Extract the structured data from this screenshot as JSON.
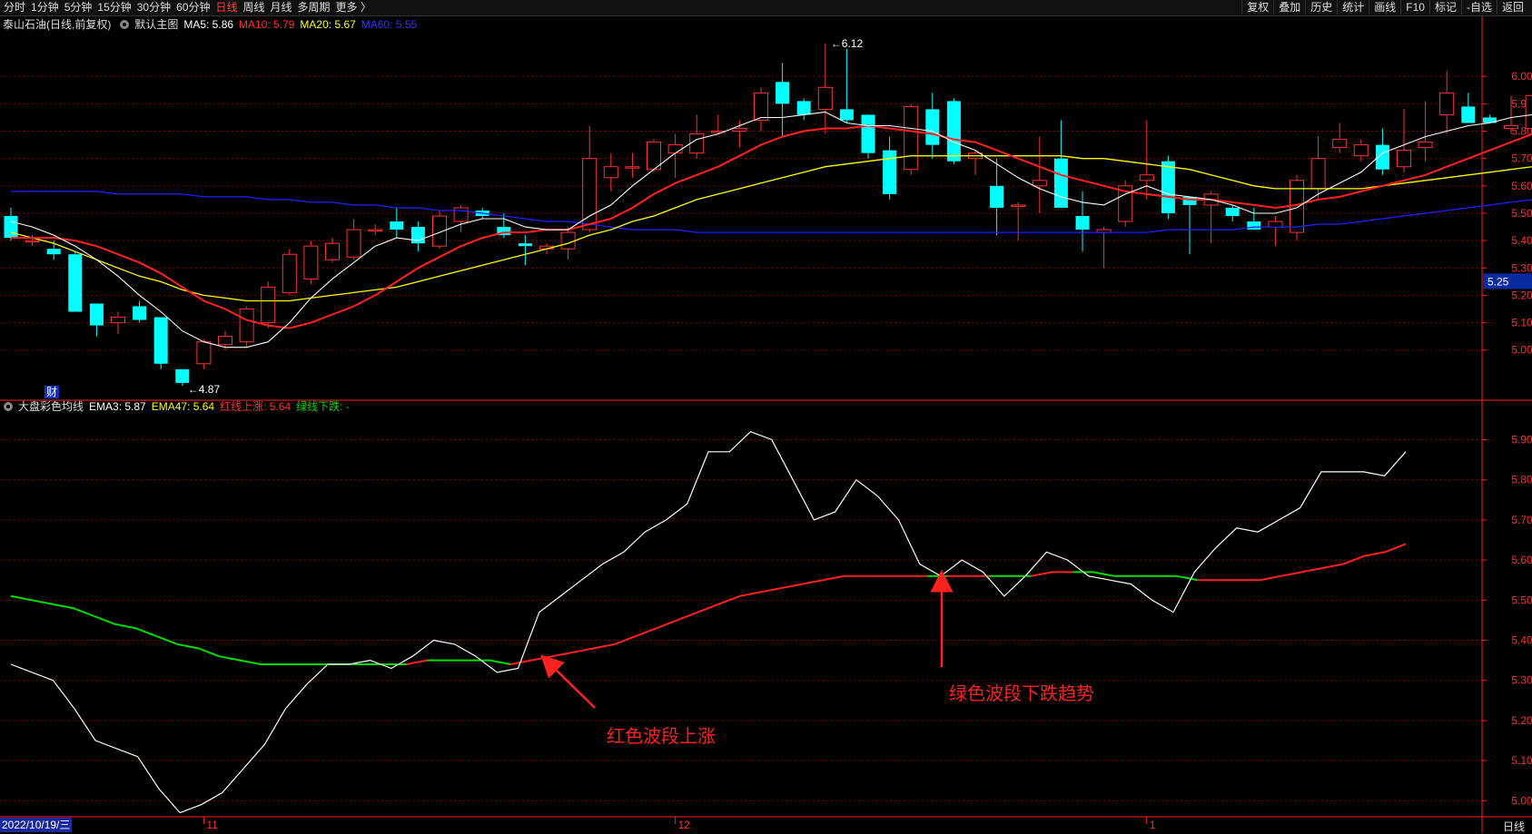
{
  "toolbar": {
    "periods": [
      "分时",
      "1分钟",
      "5分钟",
      "15分钟",
      "30分钟",
      "60分钟",
      "日线",
      "周线",
      "月线",
      "多周期",
      "更多 〉"
    ],
    "active_period": "日线",
    "right_buttons": [
      "复权",
      "叠加",
      "历史",
      "统计",
      "画线",
      "F10",
      "标记",
      "-自选",
      "返回"
    ]
  },
  "main_info": {
    "stock": "泰山石油(日线,前复权)",
    "indicator": "默认主图",
    "ma5": "MA5: 5.86",
    "ma10": "MA10: 5.79",
    "ma20": "MA20: 5.67",
    "ma60": "MA60: 5.55"
  },
  "sub_info": {
    "indicator": "大盘彩色均线",
    "ema3": "EMA3: 5.87",
    "ema47": "EMA47: 5.64",
    "red": "红线上涨: 5.64",
    "green": "绿线下跌: -"
  },
  "colors": {
    "up": "#ff3232",
    "down": "#00ffff",
    "ma5": "#ffffff",
    "ma10": "#ff2020",
    "ma20": "#ffff00",
    "ma60": "#2020ff",
    "ema_up": "#ff2020",
    "ema_down": "#00dd00",
    "grid": "#8b0000",
    "axis": "#ff2020",
    "price_tag_bg": "#0a2aa0"
  },
  "markers": {
    "high": "6.12",
    "low": "4.87",
    "current_price": "5.25",
    "cai_badge": "财"
  },
  "date_label": "2022/10/19/三",
  "period_label_br": "日线",
  "x_ticks": [
    {
      "label": "11",
      "index": 9
    },
    {
      "label": "12",
      "index": 31
    },
    {
      "label": "1",
      "index": 53
    }
  ],
  "annotations": {
    "red_wave": "红色波段上涨",
    "green_wave": "绿色波段下跌趋势"
  },
  "chart_data": [
    {
      "type": "candlestick",
      "title": "泰山石油(日线,前复权)",
      "ylim": [
        4.82,
        6.16
      ],
      "y_ticks": [
        5.0,
        5.1,
        5.2,
        5.3,
        5.4,
        5.5,
        5.6,
        5.7,
        5.8,
        5.9,
        6.0
      ],
      "candles": [
        [
          5.49,
          5.52,
          5.4,
          5.41
        ],
        [
          5.4,
          5.42,
          5.38,
          5.4
        ],
        [
          5.37,
          5.4,
          5.33,
          5.35
        ],
        [
          5.35,
          5.36,
          5.14,
          5.14
        ],
        [
          5.17,
          5.17,
          5.05,
          5.09
        ],
        [
          5.1,
          5.14,
          5.06,
          5.12
        ],
        [
          5.16,
          5.18,
          5.1,
          5.11
        ],
        [
          5.12,
          5.12,
          4.93,
          4.95
        ],
        [
          4.93,
          4.93,
          4.87,
          4.88
        ],
        [
          4.95,
          5.04,
          4.93,
          5.03
        ],
        [
          5.02,
          5.07,
          5.0,
          5.05
        ],
        [
          5.03,
          5.16,
          5.01,
          5.15
        ],
        [
          5.1,
          5.25,
          5.08,
          5.23
        ],
        [
          5.21,
          5.37,
          5.2,
          5.35
        ],
        [
          5.26,
          5.4,
          5.24,
          5.38
        ],
        [
          5.33,
          5.41,
          5.32,
          5.39
        ],
        [
          5.34,
          5.48,
          5.33,
          5.44
        ],
        [
          5.44,
          5.46,
          5.42,
          5.44
        ],
        [
          5.47,
          5.52,
          5.41,
          5.44
        ],
        [
          5.45,
          5.47,
          5.36,
          5.39
        ],
        [
          5.38,
          5.51,
          5.37,
          5.49
        ],
        [
          5.47,
          5.53,
          5.43,
          5.52
        ],
        [
          5.51,
          5.52,
          5.48,
          5.49
        ],
        [
          5.45,
          5.5,
          5.41,
          5.42
        ],
        [
          5.39,
          5.42,
          5.31,
          5.38
        ],
        [
          5.37,
          5.39,
          5.35,
          5.38
        ],
        [
          5.37,
          5.45,
          5.33,
          5.43
        ],
        [
          5.44,
          5.82,
          5.43,
          5.7
        ],
        [
          5.63,
          5.72,
          5.58,
          5.67
        ],
        [
          5.67,
          5.72,
          5.63,
          5.67
        ],
        [
          5.66,
          5.77,
          5.65,
          5.76
        ],
        [
          5.72,
          5.79,
          5.63,
          5.75
        ],
        [
          5.72,
          5.86,
          5.7,
          5.79
        ],
        [
          5.8,
          5.86,
          5.79,
          5.8
        ],
        [
          5.8,
          5.84,
          5.74,
          5.81
        ],
        [
          5.84,
          5.96,
          5.8,
          5.94
        ],
        [
          5.98,
          6.05,
          5.78,
          5.9
        ],
        [
          5.91,
          5.92,
          5.84,
          5.86
        ],
        [
          5.88,
          6.12,
          5.79,
          5.96
        ],
        [
          5.88,
          6.1,
          5.83,
          5.84
        ],
        [
          5.86,
          5.86,
          5.7,
          5.72
        ],
        [
          5.73,
          5.78,
          5.55,
          5.57
        ],
        [
          5.66,
          5.9,
          5.64,
          5.89
        ],
        [
          5.88,
          5.94,
          5.7,
          5.75
        ],
        [
          5.91,
          5.92,
          5.68,
          5.69
        ],
        [
          5.7,
          5.73,
          5.64,
          5.72
        ],
        [
          5.6,
          5.7,
          5.42,
          5.52
        ],
        [
          5.53,
          5.54,
          5.4,
          5.53
        ],
        [
          5.6,
          5.78,
          5.5,
          5.62
        ],
        [
          5.7,
          5.84,
          5.55,
          5.52
        ],
        [
          5.49,
          5.58,
          5.36,
          5.44
        ],
        [
          5.43,
          5.45,
          5.3,
          5.44
        ],
        [
          5.47,
          5.62,
          5.45,
          5.6
        ],
        [
          5.62,
          5.84,
          5.55,
          5.64
        ],
        [
          5.69,
          5.71,
          5.48,
          5.5
        ],
        [
          5.56,
          5.56,
          5.35,
          5.53
        ],
        [
          5.53,
          5.58,
          5.39,
          5.57
        ],
        [
          5.52,
          5.53,
          5.47,
          5.49
        ],
        [
          5.47,
          5.52,
          5.44,
          5.44
        ],
        [
          5.45,
          5.49,
          5.38,
          5.47
        ],
        [
          5.43,
          5.64,
          5.4,
          5.62
        ],
        [
          5.59,
          5.78,
          5.55,
          5.7
        ],
        [
          5.74,
          5.83,
          5.72,
          5.77
        ],
        [
          5.71,
          5.77,
          5.69,
          5.75
        ],
        [
          5.75,
          5.81,
          5.64,
          5.66
        ],
        [
          5.67,
          5.88,
          5.65,
          5.73
        ],
        [
          5.74,
          5.91,
          5.69,
          5.76
        ],
        [
          5.86,
          6.02,
          5.79,
          5.94
        ],
        [
          5.89,
          5.94,
          5.83,
          5.83
        ],
        [
          5.85,
          5.86,
          5.83,
          5.83
        ],
        [
          5.81,
          5.93,
          5.79,
          5.82
        ],
        [
          5.81,
          5.94,
          5.75,
          5.93
        ]
      ],
      "ma5": [
        5.47,
        5.45,
        5.42,
        5.38,
        5.33,
        5.27,
        5.2,
        5.14,
        5.07,
        5.03,
        5.01,
        5.01,
        5.03,
        5.1,
        5.19,
        5.26,
        5.32,
        5.38,
        5.41,
        5.4,
        5.43,
        5.46,
        5.48,
        5.48,
        5.45,
        5.44,
        5.44,
        5.49,
        5.53,
        5.6,
        5.66,
        5.72,
        5.77,
        5.79,
        5.82,
        5.85,
        5.85,
        5.86,
        5.87,
        5.83,
        5.82,
        5.82,
        5.81,
        5.8,
        5.76,
        5.73,
        5.68,
        5.63,
        5.59,
        5.56,
        5.54,
        5.53,
        5.57,
        5.6,
        5.57,
        5.56,
        5.55,
        5.53,
        5.5,
        5.5,
        5.52,
        5.57,
        5.61,
        5.65,
        5.72,
        5.75,
        5.78,
        5.8,
        5.82,
        5.83,
        5.85,
        5.86
      ],
      "ma10": [
        5.41,
        5.41,
        5.41,
        5.4,
        5.38,
        5.35,
        5.32,
        5.28,
        5.23,
        5.18,
        5.15,
        5.11,
        5.09,
        5.08,
        5.1,
        5.13,
        5.16,
        5.2,
        5.25,
        5.3,
        5.34,
        5.38,
        5.41,
        5.43,
        5.43,
        5.44,
        5.44,
        5.46,
        5.48,
        5.52,
        5.57,
        5.61,
        5.64,
        5.67,
        5.71,
        5.75,
        5.78,
        5.8,
        5.81,
        5.81,
        5.82,
        5.81,
        5.8,
        5.79,
        5.77,
        5.76,
        5.73,
        5.7,
        5.67,
        5.64,
        5.62,
        5.6,
        5.58,
        5.57,
        5.56,
        5.55,
        5.55,
        5.54,
        5.53,
        5.52,
        5.53,
        5.55,
        5.56,
        5.58,
        5.6,
        5.62,
        5.64,
        5.67,
        5.7,
        5.73,
        5.76,
        5.79
      ],
      "ma20": [
        5.43,
        5.41,
        5.39,
        5.36,
        5.33,
        5.3,
        5.27,
        5.25,
        5.22,
        5.2,
        5.19,
        5.18,
        5.18,
        5.18,
        5.19,
        5.2,
        5.21,
        5.22,
        5.23,
        5.25,
        5.27,
        5.29,
        5.31,
        5.33,
        5.35,
        5.37,
        5.39,
        5.42,
        5.44,
        5.47,
        5.49,
        5.52,
        5.55,
        5.57,
        5.59,
        5.61,
        5.63,
        5.65,
        5.67,
        5.68,
        5.69,
        5.7,
        5.71,
        5.71,
        5.71,
        5.71,
        5.71,
        5.71,
        5.71,
        5.71,
        5.7,
        5.7,
        5.69,
        5.68,
        5.67,
        5.66,
        5.64,
        5.62,
        5.6,
        5.59,
        5.59,
        5.59,
        5.59,
        5.59,
        5.6,
        5.61,
        5.62,
        5.63,
        5.64,
        5.65,
        5.66,
        5.67
      ],
      "ma60": [
        5.58,
        5.58,
        5.58,
        5.58,
        5.58,
        5.57,
        5.57,
        5.57,
        5.57,
        5.56,
        5.56,
        5.56,
        5.55,
        5.55,
        5.54,
        5.54,
        5.53,
        5.53,
        5.52,
        5.52,
        5.51,
        5.51,
        5.5,
        5.49,
        5.48,
        5.47,
        5.47,
        5.46,
        5.45,
        5.44,
        5.44,
        5.44,
        5.43,
        5.43,
        5.43,
        5.43,
        5.43,
        5.43,
        5.43,
        5.43,
        5.43,
        5.43,
        5.43,
        5.43,
        5.43,
        5.43,
        5.43,
        5.43,
        5.43,
        5.43,
        5.43,
        5.43,
        5.43,
        5.43,
        5.44,
        5.44,
        5.44,
        5.44,
        5.45,
        5.45,
        5.45,
        5.46,
        5.46,
        5.47,
        5.48,
        5.49,
        5.5,
        5.51,
        5.52,
        5.53,
        5.54,
        5.55
      ]
    },
    {
      "type": "line",
      "title": "大盘彩色均线",
      "ylim": [
        4.96,
        5.96
      ],
      "y_ticks": [
        5.0,
        5.1,
        5.2,
        5.3,
        5.4,
        5.5,
        5.6,
        5.7,
        5.8,
        5.9
      ],
      "series": [
        {
          "name": "EMA3",
          "values": [
            5.34,
            5.32,
            5.3,
            5.23,
            5.15,
            5.13,
            5.11,
            5.03,
            4.97,
            4.99,
            5.02,
            5.08,
            5.14,
            5.23,
            5.29,
            5.34,
            5.34,
            5.35,
            5.33,
            5.36,
            5.4,
            5.39,
            5.36,
            5.32,
            5.33,
            5.47,
            5.51,
            5.55,
            5.59,
            5.62,
            5.67,
            5.7,
            5.74,
            5.87,
            5.87,
            5.92,
            5.9,
            5.8,
            5.7,
            5.72,
            5.8,
            5.76,
            5.7,
            5.59,
            5.56,
            5.6,
            5.57,
            5.51,
            5.56,
            5.62,
            5.6,
            5.56,
            5.55,
            5.54,
            5.5,
            5.47,
            5.57,
            5.63,
            5.68,
            5.67,
            5.7,
            5.73,
            5.82,
            5.82,
            5.82,
            5.81,
            5.87
          ]
        },
        {
          "name": "EMA47",
          "values": [
            5.51,
            5.5,
            5.49,
            5.48,
            5.46,
            5.44,
            5.43,
            5.41,
            5.39,
            5.38,
            5.36,
            5.35,
            5.34,
            5.34,
            5.34,
            5.34,
            5.34,
            5.34,
            5.34,
            5.34,
            5.35,
            5.35,
            5.35,
            5.35,
            5.34,
            5.35,
            5.36,
            5.37,
            5.38,
            5.39,
            5.41,
            5.43,
            5.45,
            5.47,
            5.49,
            5.51,
            5.52,
            5.53,
            5.54,
            5.55,
            5.56,
            5.56,
            5.56,
            5.56,
            5.56,
            5.56,
            5.56,
            5.56,
            5.56,
            5.56,
            5.57,
            5.57,
            5.57,
            5.56,
            5.56,
            5.56,
            5.56,
            5.55,
            5.55,
            5.55,
            5.55,
            5.56,
            5.57,
            5.58,
            5.59,
            5.61,
            5.62,
            5.64
          ],
          "color_segments": "green before red-turn at index 24; mixed after"
        }
      ]
    }
  ]
}
